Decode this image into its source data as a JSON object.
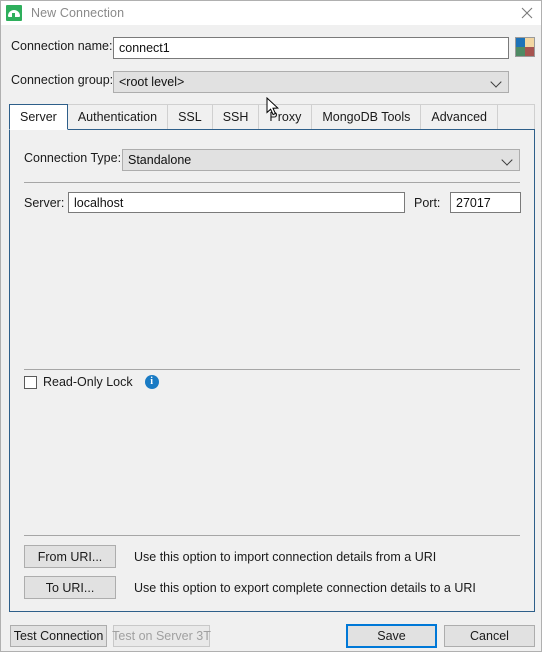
{
  "window": {
    "title": "New Connection",
    "app_icon": "mongodb-leaf-icon",
    "close_icon": "close-icon"
  },
  "form": {
    "connection_name_label": "Connection name:",
    "connection_name_value": "connect1",
    "connection_group_label": "Connection group:",
    "connection_group_value": "<root level>",
    "color_swatch": {
      "name": "color-swatch-button",
      "colors": [
        "#1d72b8",
        "#f2d6a2",
        "#4e8a64",
        "#a6534f"
      ]
    }
  },
  "tabs": [
    {
      "label": "Server",
      "active": true
    },
    {
      "label": "Authentication",
      "active": false
    },
    {
      "label": "SSL",
      "active": false
    },
    {
      "label": "SSH",
      "active": false
    },
    {
      "label": "Proxy",
      "active": false
    },
    {
      "label": "MongoDB Tools",
      "active": false
    },
    {
      "label": "Advanced",
      "active": false
    }
  ],
  "server_tab": {
    "connection_type_label": "Connection Type:",
    "connection_type_value": "Standalone",
    "server_label": "Server:",
    "server_value": "localhost",
    "port_label": "Port:",
    "port_value": "27017",
    "read_only_lock_label": "Read-Only Lock",
    "read_only_lock_checked": false,
    "info_icon": "info-icon",
    "from_uri_button": "From URI...",
    "from_uri_hint": "Use this option to import connection details from a URI",
    "to_uri_button": "To URI...",
    "to_uri_hint": "Use this option to export complete connection details to a URI"
  },
  "footer": {
    "test_connection": "Test Connection",
    "test_on_server_3t": "Test on Server 3T",
    "test_on_server_3t_disabled": true,
    "save": "Save",
    "cancel": "Cancel"
  },
  "colors": {
    "accent_blue": "#0078d7",
    "tab_border": "#2e5f8a",
    "panel_bg": "#f0f0f0",
    "info_blue": "#1a7bc4",
    "app_green": "#2eaf5c"
  }
}
